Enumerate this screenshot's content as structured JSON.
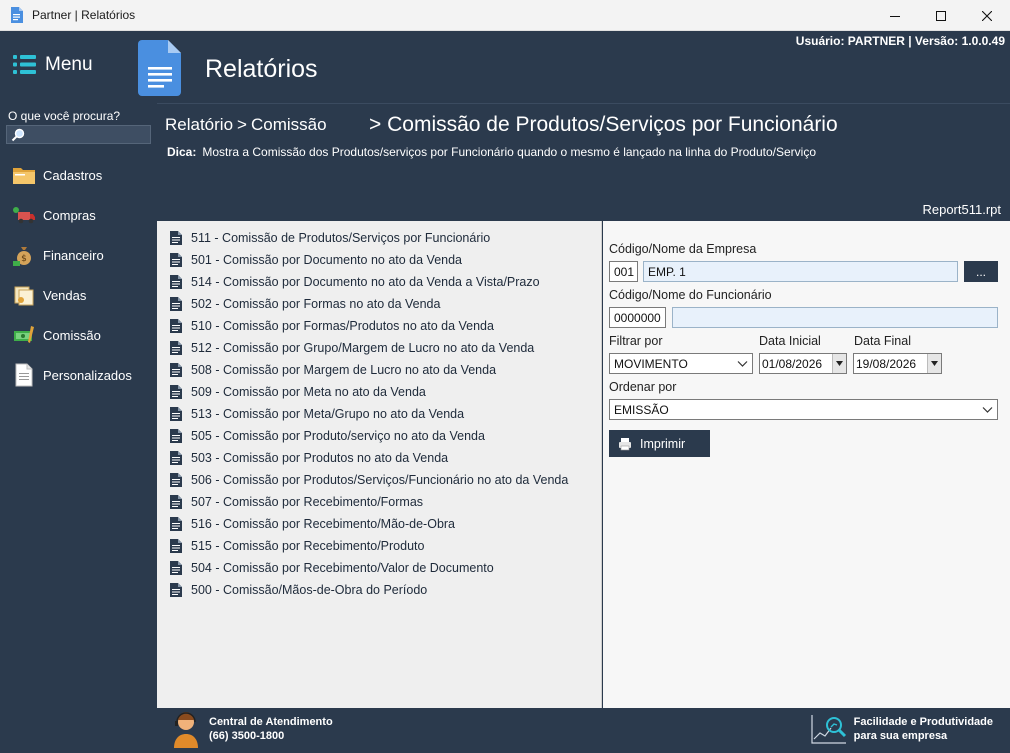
{
  "window": {
    "title": "Partner | Relatórios"
  },
  "header": {
    "menu_label": "Menu",
    "page_title": "Relatórios",
    "user_info": "Usuário: PARTNER | Versão: 1.0.0.49"
  },
  "sidebar": {
    "search_label": "O que você procura?",
    "items": [
      {
        "label": "Cadastros",
        "icon": "folder-icon"
      },
      {
        "label": "Compras",
        "icon": "delivery-truck-icon"
      },
      {
        "label": "Financeiro",
        "icon": "money-bag-icon"
      },
      {
        "label": "Vendas",
        "icon": "sales-papers-icon"
      },
      {
        "label": "Comissão",
        "icon": "cash-register-icon"
      },
      {
        "label": "Personalizados",
        "icon": "document-icon"
      }
    ]
  },
  "breadcrumb": {
    "part1": "Relatório",
    "sep1": ">",
    "part2": "Comissão",
    "sep2": ">",
    "title": "Comissão de Produtos/Serviços por Funcionário"
  },
  "tip": {
    "label": "Dica:",
    "text": "Mostra a Comissão dos Produtos/serviços por Funcionário quando o mesmo é lançado na linha do Produto/Serviço"
  },
  "report_file": "Report511.rpt",
  "reports": [
    "511 - Comissão de Produtos/Serviços por Funcionário",
    "501 - Comissão por Documento no ato da Venda",
    "514 - Comissão por Documento no ato da Venda a Vista/Prazo",
    "502 - Comissão por Formas no ato da Venda",
    "510 - Comissão por Formas/Produtos no ato da Venda",
    "512 - Comissão por Grupo/Margem de Lucro no ato da Venda",
    "508 - Comissão por Margem de Lucro no ato da Venda",
    "509 - Comissão por Meta no ato da Venda",
    "513 - Comissão por Meta/Grupo no ato da Venda",
    "505 - Comissão por Produto/serviço no ato da Venda",
    "503 - Comissão por Produtos no ato da Venda",
    "506 - Comissão por Produtos/Serviços/Funcionário no ato da Venda",
    "507 - Comissão por Recebimento/Formas",
    "516 - Comissão por Recebimento/Mão-de-Obra",
    "515 - Comissão por Recebimento/Produto",
    "504 - Comissão por Recebimento/Valor de Documento",
    "500 - Comissão/Mãos-de-Obra do Período"
  ],
  "form": {
    "empresa_label": "Código/Nome da Empresa",
    "empresa_code": "001",
    "empresa_name": "EMP. 1",
    "empresa_browse": "...",
    "funcionario_label": "Código/Nome do Funcionário",
    "funcionario_code": "0000000",
    "funcionario_name": "",
    "filtrar_label": "Filtrar por",
    "filtrar_value": "MOVIMENTO",
    "data_inicial_label": "Data Inicial",
    "data_inicial": "01/08/2026",
    "data_final_label": "Data Final",
    "data_final": "19/08/2026",
    "ordenar_label": "Ordenar por",
    "ordenar_value": "EMISSÃO",
    "print_label": "Imprimir"
  },
  "footer": {
    "support_line1": "Central de Atendimento",
    "support_line2": "(66) 3500-1800",
    "slogan_line1": "Facilidade e Produtividade",
    "slogan_line2": "para sua empresa"
  },
  "colors": {
    "chrome": "#2b3a4d",
    "list_bg": "#efefef",
    "form_bg": "#f7f7f7",
    "accent_blue": "#4a8fe0"
  }
}
